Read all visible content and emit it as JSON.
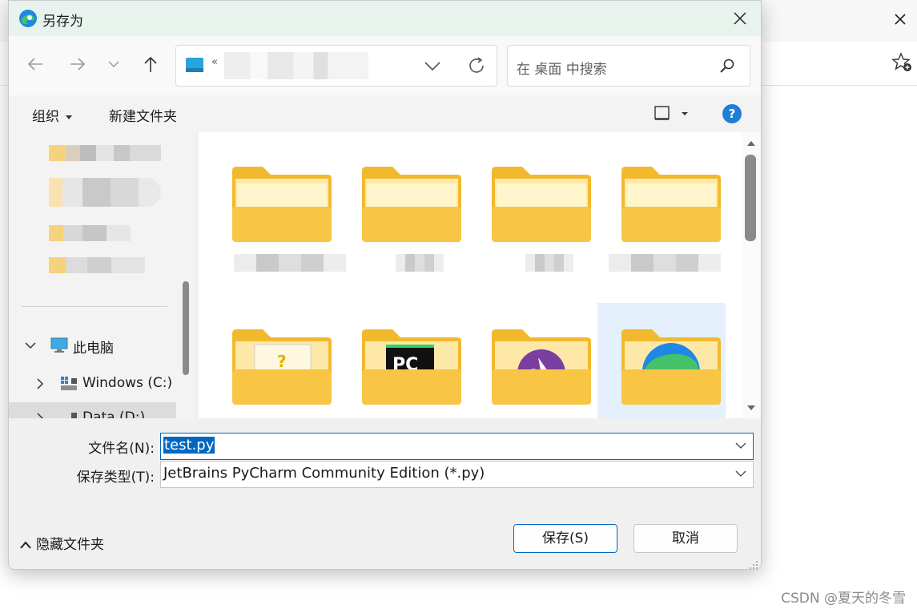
{
  "dialog": {
    "title": "另存为",
    "search_placeholder": "在 桌面 中搜索",
    "address_chevron": "«",
    "commands": {
      "organize": "组织",
      "new_folder": "新建文件夹"
    },
    "help_glyph": "?",
    "tree": [
      {
        "label": "此电脑",
        "expanded": true
      },
      {
        "label": "Windows (C:)",
        "expanded": false
      },
      {
        "label": "Data (D:)",
        "expanded": false,
        "selected": true
      }
    ],
    "folders": [
      {
        "icon": "folder-icon",
        "selected": false
      },
      {
        "icon": "folder-icon",
        "selected": false
      },
      {
        "icon": "folder-icon",
        "selected": false
      },
      {
        "icon": "folder-icon",
        "selected": false
      },
      {
        "icon": "folder-icon",
        "selected": false
      },
      {
        "icon": "pycharm-folder-icon",
        "badge": "PC",
        "selected": false
      },
      {
        "icon": "folder-icon",
        "selected": false
      },
      {
        "icon": "edge-folder-icon",
        "selected": true
      }
    ],
    "filename_label": "文件名(N):",
    "filename_value": "test.py",
    "filetype_label": "保存类型(T):",
    "filetype_value": "JetBrains PyCharm Community Edition (*.py)",
    "hide_folders": "隐藏文件夹",
    "save_button": "保存(S)",
    "cancel_button": "取消"
  },
  "watermark": "CSDN @夏天的冬雪",
  "colors": {
    "accent": "#0067c0",
    "folder_yellow": "#f8c544",
    "title_bg": "#e8f3ee"
  }
}
